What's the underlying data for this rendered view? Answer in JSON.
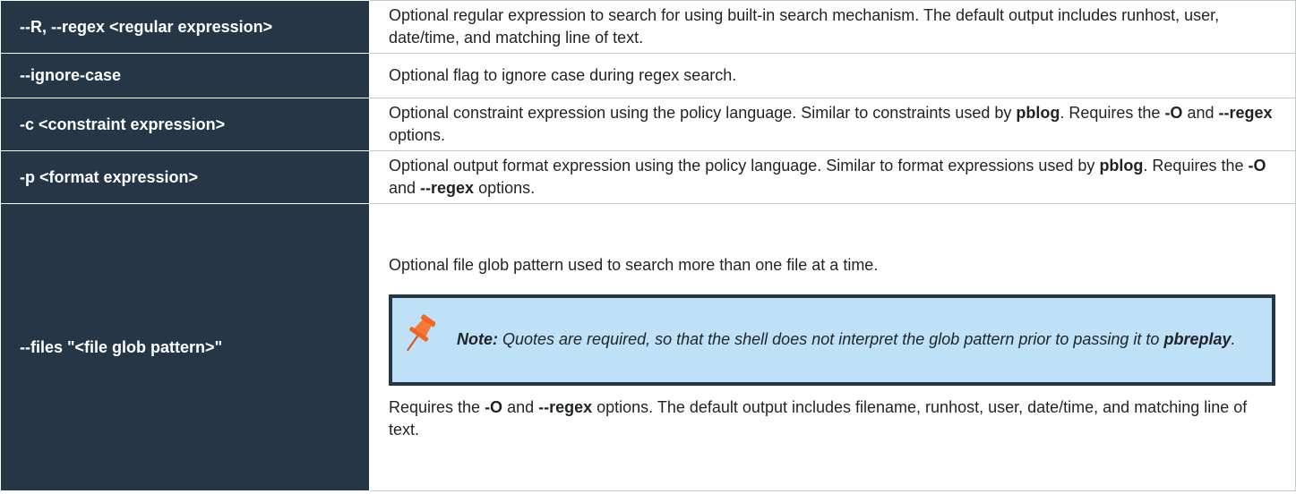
{
  "rows": [
    {
      "option": "--R, --regex <regular expression>",
      "description": "Optional regular expression to search for using built-in search mechanism. The default output includes runhost, user, date/time, and matching line of text."
    },
    {
      "option": "--ignore-case",
      "description": "Optional flag to ignore case during regex search."
    },
    {
      "option": "-c <constraint expression>",
      "desc_1": "Optional constraint expression using the policy language. Similar to constraints used by ",
      "desc_b1": "pblog",
      "desc_2": ". Requires the ",
      "desc_b2": "-O",
      "desc_3": " and ",
      "desc_b3": "--regex",
      "desc_4": " options."
    },
    {
      "option": "-p <format expression>",
      "desc_1": "Optional output format expression using the policy language. Similar to format expressions used by ",
      "desc_b1": "pblog",
      "desc_2": ". Requires the ",
      "desc_b2": "-O",
      "desc_3": " and ",
      "desc_b3": "--regex",
      "desc_4": " options."
    },
    {
      "option": "--files \"<file glob pattern>\"",
      "intro": "Optional file glob pattern used to search more than one file at a time.",
      "note": {
        "label": "Note:",
        "text": " Quotes are required, so that the shell does not interpret the glob pattern prior to passing it to ",
        "bold": "pbreplay",
        "end": "."
      },
      "desc_1": "Requires the ",
      "desc_b1": "-O",
      "desc_2": " and ",
      "desc_b2": "--regex",
      "desc_3": " options. The default output includes filename, runhost, user, date/time, and matching line of text."
    }
  ],
  "colors": {
    "header_bg": "#253746",
    "note_bg": "#bfe1f7",
    "pin_icon": "#f26522"
  },
  "icons": {
    "note": "pushpin-icon"
  }
}
